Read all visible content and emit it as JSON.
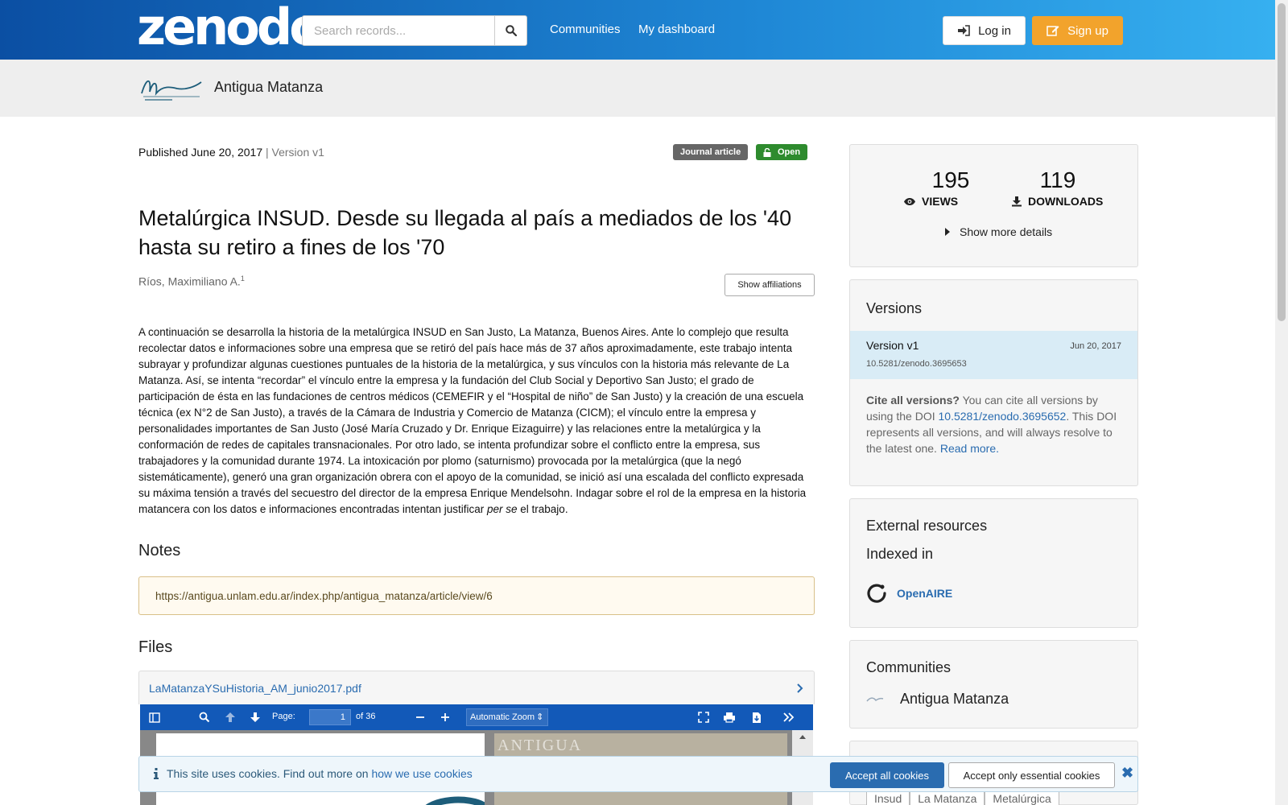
{
  "header": {
    "logo": "zenodo",
    "search_placeholder": "Search records...",
    "nav": [
      "Communities",
      "My dashboard"
    ],
    "login_label": "Log in",
    "signup_label": "Sign up"
  },
  "community_bar": {
    "name": "Antigua Matanza"
  },
  "record": {
    "published": "Published June 20, 2017",
    "version": " | Version v1",
    "badge_type": "Journal article",
    "badge_access": "Open",
    "title": "Metalúrgica INSUD. Desde su llegada al país a mediados de los '40 hasta su retiro a fines de los '70",
    "creator": "Ríos, Maximiliano A.",
    "creator_sup": "1",
    "affiliations_label": "Show affiliations",
    "abstract_part1": "A continuación se desarrolla la historia de la metalúrgica INSUD en San Justo, La Matanza, Buenos Aires. Ante lo complejo que resulta recolectar datos e informaciones sobre una empresa que se retiró del país hace más de 37 años aproximadamente, este trabajo intenta subrayar y profundizar algunas cuestiones  puntuales de la historia de la metalúrgica,  y sus vínculos con la historia más relevante de La Matanza. Así, se intenta “recordar” el vínculo entre la empresa  y la fundación del Club Social y Deportivo San Justo; el grado de participación de ésta en las fundaciones de centros médicos (CEMEFIR y el “Hospital de niño” de San Justo) y la creación de una escuela técnica (ex N°2 de San Justo), a través de la Cámara de Industria y Comercio de Matanza (CICM); el vínculo entre la empresa y personalidades importantes de San Justo (José María Cruzado y Dr. Enrique Eizaguirre) y las relaciones entre la metalúrgica y la conformación de redes de capitales transnacionales. Por otro lado, se intenta profundizar sobre el conflicto entre la empresa, sus trabajadores y la comunidad durante 1974. La intoxicación por plomo (saturnismo) provocada por la metalúrgica (que la negó sistemáticamente), generó una gran organización obrera con el apoyo de la comunidad, se inició así una escalada del conflicto expresada su máxima tensión a través del secuestro del director de la empresa Enrique Mendelsohn. Indagar sobre el rol de la empresa en la historia matancera con los datos e informaciones encontradas intentan justificar ",
    "abstract_em": "per se",
    "abstract_part2": " el trabajo.",
    "notes_heading": "Notes",
    "notes_url": "https://antigua.unlam.edu.ar/index.php/antigua_matanza/article/view/6",
    "files_heading": "Files",
    "file_name": "LaMatanzaYSuHistoria_AM_junio2017.pdf"
  },
  "pdf_viewer": {
    "page_label": "Page:",
    "page_value": "1",
    "page_total": "of 36",
    "zoom": "Automatic Zoom",
    "watermark": "ANTIGUA"
  },
  "sidebar": {
    "views_count": "195",
    "views_label": "VIEWS",
    "downloads_count": "119",
    "downloads_label": "DOWNLOADS",
    "more_details": "Show more details",
    "versions_title": "Versions",
    "version_name": "Version v1",
    "version_date": "Jun 20, 2017",
    "version_doi": "10.5281/zenodo.3695653",
    "cite_bold": "Cite all versions?",
    "cite_text1": " You can cite all versions by using the DOI ",
    "cite_doi": "10.5281/zenodo.3695652",
    "cite_text2": ". This DOI represents all versions, and will always resolve to the latest one. ",
    "cite_read_more": "Read more.",
    "external_title": "External resources",
    "indexed_in": "Indexed in",
    "openaire": "OpenAIRE",
    "communities_title": "Communities",
    "community_item": "Antigua Matanza",
    "keywords": [
      "Insud",
      "La Matanza",
      "Metalúrgica"
    ]
  },
  "cookie": {
    "text": "This site uses cookies. Find out more on ",
    "link": "how we use cookies",
    "accept_all": "Accept all cookies",
    "accept_essential": "Accept only essential cookies"
  }
}
